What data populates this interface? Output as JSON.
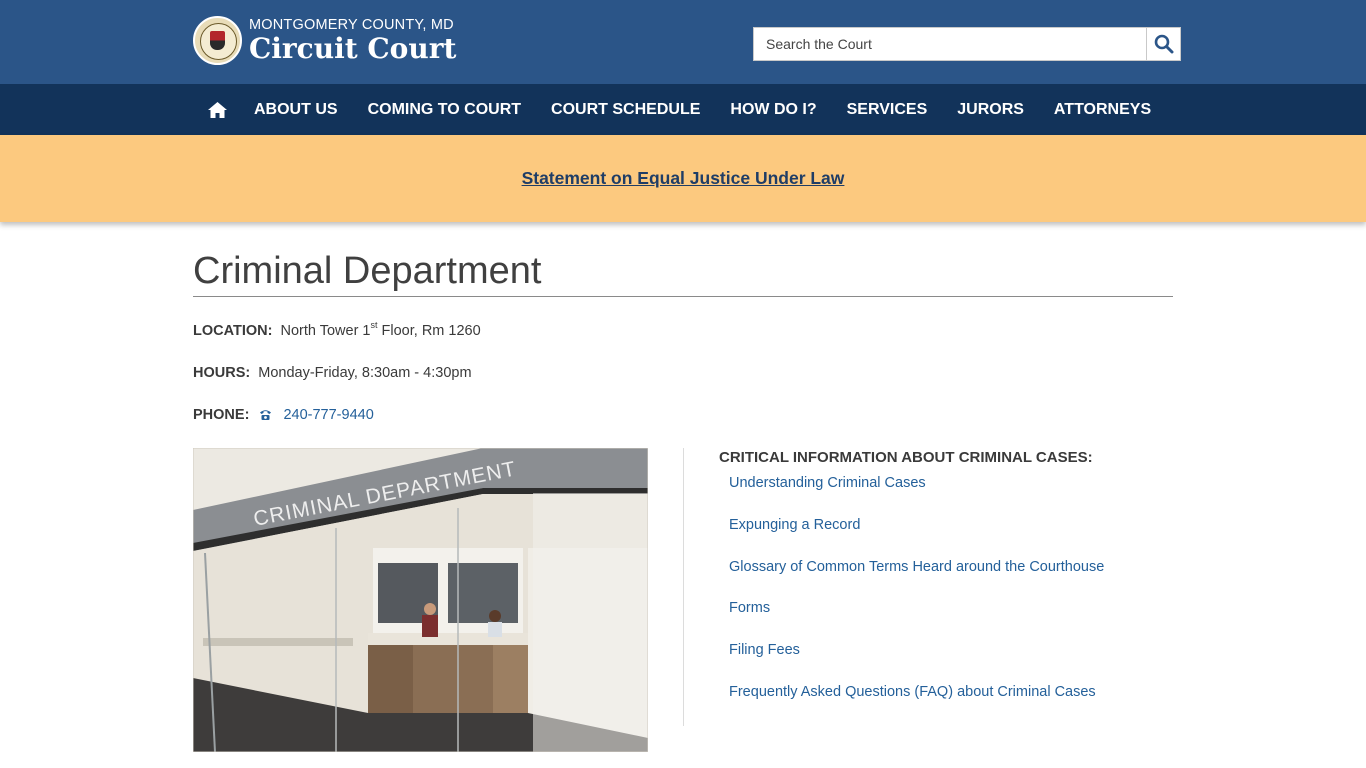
{
  "header": {
    "county": "MONTGOMERY COUNTY, MD",
    "court": "Circuit Court",
    "search_placeholder": "Search the Court",
    "brand_color": "#2b5588"
  },
  "nav": {
    "home_icon": "home-icon",
    "items": [
      "ABOUT US",
      "COMING TO COURT",
      "COURT SCHEDULE",
      "HOW DO I?",
      "SERVICES",
      "JURORS",
      "ATTORNEYS"
    ],
    "bg_color": "#12335a"
  },
  "banner": {
    "text": "Statement on Equal Justice Under Law",
    "bg_color": "#fcc97f"
  },
  "page": {
    "title": "Criminal Department",
    "location_label": "LOCATION:",
    "location_value_prefix": "North Tower 1",
    "location_value_sup": "st",
    "location_value_suffix": " Floor, Rm 1260",
    "hours_label": "HOURS:",
    "hours_value": "Monday-Friday, 8:30am - 4:30pm",
    "phone_label": "PHONE:",
    "phone_icon": "phone-icon",
    "phone_value": "240-777-9440",
    "photo_sign_text": "CRIMINAL DEPARTMENT"
  },
  "critical": {
    "heading": "CRITICAL INFORMATION ABOUT CRIMINAL CASES:",
    "links": [
      "Understanding Criminal Cases",
      "Expunging a Record",
      "Glossary of Common Terms Heard around the Courthouse",
      "Forms",
      "Filing Fees",
      "Frequently Asked Questions (FAQ) about Criminal Cases"
    ]
  }
}
